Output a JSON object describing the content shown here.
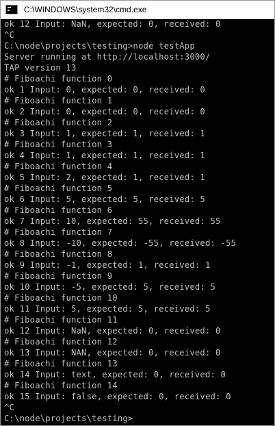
{
  "window": {
    "title": "C:\\WINDOWS\\system32\\cmd.exe",
    "icon": "cmd-icon"
  },
  "console": {
    "lines": [
      "ok 12 Input: NaN, expected: 0, received: 0",
      "^C",
      "C:\\node\\projects\\testing>node testApp",
      "Server running at http://localhost:3000/",
      "TAP version 13",
      "# Fiboachi function 0",
      "ok 1 Input: 0, expected: 0, received: 0",
      "# Fiboachi function 1",
      "ok 2 Input: 0, expected: 0, received: 0",
      "# Fiboachi function 2",
      "ok 3 Input: 1, expected: 1, received: 1",
      "# Fiboachi function 3",
      "ok 4 Input: 1, expected: 1, received: 1",
      "# Fiboachi function 4",
      "ok 5 Input: 2, expected: 1, received: 1",
      "# Fiboachi function 5",
      "ok 6 Input: 5, expected: 5, received: 5",
      "# Fiboachi function 6",
      "ok 7 Input: 10, expected: 55, received: 55",
      "# Fiboachi function 7",
      "ok 8 Input: -10, expected: -55, received: -55",
      "# Fiboachi function 8",
      "ok 9 Input: -1, expected: 1, received: 1",
      "# Fiboachi function 9",
      "ok 10 Input: -5, expected: 5, received: 5",
      "# Fiboachi function 10",
      "ok 11 Input: 5, expected: 5, received: 5",
      "# Fiboachi function 11",
      "ok 12 Input: NaN, expected: 0, received: 0",
      "# Fiboachi function 12",
      "ok 13 Input: NAN, expected: 0, received: 0",
      "# Fiboachi function 13",
      "ok 14 Input: text, expected: 0, received: 0",
      "# Fiboachi function 14",
      "ok 15 Input: false, expected: 0, received: 0",
      "^C",
      "C:\\node\\projects\\testing>"
    ]
  },
  "colors": {
    "background": "#000000",
    "text": "#c0c0c0",
    "titlebar": "#ffffff"
  }
}
